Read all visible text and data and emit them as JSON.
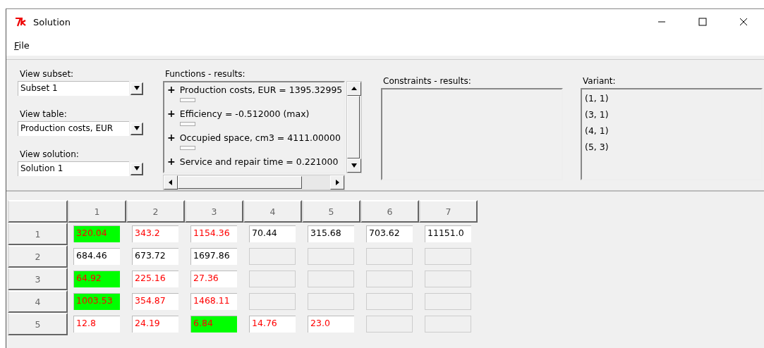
{
  "window": {
    "title": "Solution"
  },
  "menu": [
    {
      "label": "File"
    }
  ],
  "combos": [
    {
      "label": "View subset:",
      "value": "Subset 1"
    },
    {
      "label": "View table:",
      "value": "Production costs, EUR"
    },
    {
      "label": "View solution:",
      "value": "Solution 1"
    }
  ],
  "functions": {
    "label": "Functions - results:",
    "items": [
      {
        "marker": "+",
        "text": "Production costs, EUR = 1395.32995",
        "frame": true
      },
      {
        "marker": "+",
        "text": "Efficiency = -0.512000 (max)",
        "frame": true
      },
      {
        "marker": "+",
        "text": "Occupied space, cm3 = 4111.00000",
        "frame": true
      },
      {
        "marker": "+",
        "text": "Service and repair time = 0.221000",
        "frame": false
      }
    ]
  },
  "constraints": {
    "label": "Constraints - results:"
  },
  "variant": {
    "label": "Variant:",
    "items": [
      "(1, 1)",
      "(3, 1)",
      "(4, 1)",
      "(5, 3)"
    ]
  },
  "table": {
    "columns": [
      "1",
      "2",
      "3",
      "4",
      "5",
      "6",
      "7"
    ],
    "rows": [
      {
        "label": "1",
        "cells": [
          {
            "value": "320.04",
            "color": "#ff0000",
            "highlighted": true
          },
          {
            "value": "343.2",
            "color": "#ff0000",
            "highlighted": false
          },
          {
            "value": "1154.36",
            "color": "#ff0000",
            "highlighted": false
          },
          {
            "value": "70.44",
            "color": "#000000",
            "highlighted": false
          },
          {
            "value": "315.68",
            "color": "#000000",
            "highlighted": false
          },
          {
            "value": "703.62",
            "color": "#000000",
            "highlighted": false
          },
          {
            "value": "11151.0",
            "color": "#000000",
            "highlighted": false
          }
        ]
      },
      {
        "label": "2",
        "cells": [
          {
            "value": "684.46",
            "color": "#000000",
            "highlighted": false
          },
          {
            "value": "673.72",
            "color": "#000000",
            "highlighted": false
          },
          {
            "value": "1697.86",
            "color": "#000000",
            "highlighted": false
          },
          {
            "disabled": true
          },
          {
            "disabled": true
          },
          {
            "disabled": true
          },
          {
            "disabled": true
          }
        ]
      },
      {
        "label": "3",
        "cells": [
          {
            "value": "64.92",
            "color": "#ff0000",
            "highlighted": true
          },
          {
            "value": "225.16",
            "color": "#ff0000",
            "highlighted": false
          },
          {
            "value": "27.36",
            "color": "#ff0000",
            "highlighted": false
          },
          {
            "disabled": true
          },
          {
            "disabled": true
          },
          {
            "disabled": true
          },
          {
            "disabled": true
          }
        ]
      },
      {
        "label": "4",
        "cells": [
          {
            "value": "1003.53",
            "color": "#ff0000",
            "highlighted": true
          },
          {
            "value": "354.87",
            "color": "#ff0000",
            "highlighted": false
          },
          {
            "value": "1468.11",
            "color": "#ff0000",
            "highlighted": false
          },
          {
            "disabled": true
          },
          {
            "disabled": true
          },
          {
            "disabled": true
          },
          {
            "disabled": true
          }
        ]
      },
      {
        "label": "5",
        "cells": [
          {
            "value": "12.8",
            "color": "#ff0000",
            "highlighted": false
          },
          {
            "value": "24.19",
            "color": "#ff0000",
            "highlighted": false
          },
          {
            "value": "6.84",
            "color": "#ff0000",
            "highlighted": true
          },
          {
            "value": "14.76",
            "color": "#ff0000",
            "highlighted": false
          },
          {
            "value": "23.0",
            "color": "#ff0000",
            "highlighted": false
          },
          {
            "disabled": true
          },
          {
            "disabled": true
          }
        ]
      }
    ]
  }
}
